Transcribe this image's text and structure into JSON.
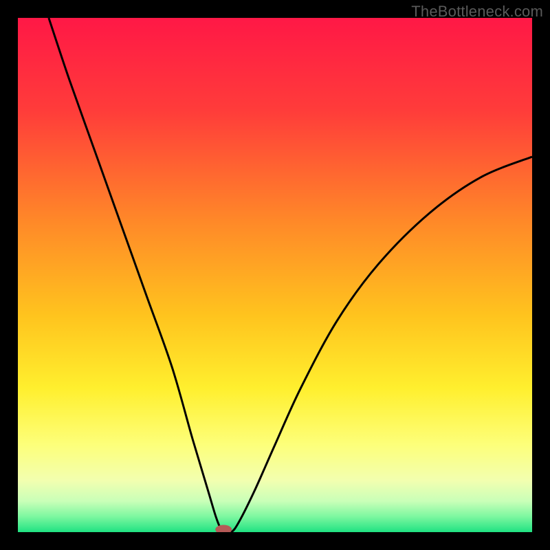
{
  "watermark": "TheBottleneck.com",
  "chart_data": {
    "type": "line",
    "title": "",
    "xlabel": "",
    "ylabel": "",
    "xlim": [
      0,
      100
    ],
    "ylim": [
      0,
      100
    ],
    "background_gradient": {
      "stops": [
        {
          "offset": 0,
          "color": "#ff1846"
        },
        {
          "offset": 18,
          "color": "#ff3c3a"
        },
        {
          "offset": 40,
          "color": "#ff8a28"
        },
        {
          "offset": 58,
          "color": "#ffc41e"
        },
        {
          "offset": 72,
          "color": "#ffef2e"
        },
        {
          "offset": 83,
          "color": "#fdff7a"
        },
        {
          "offset": 90,
          "color": "#f2ffb0"
        },
        {
          "offset": 94,
          "color": "#c9ffb8"
        },
        {
          "offset": 97,
          "color": "#7cf7a0"
        },
        {
          "offset": 100,
          "color": "#20e282"
        }
      ]
    },
    "series": [
      {
        "name": "bottleneck_curve",
        "x": [
          6,
          10,
          15,
          20,
          25,
          30,
          34,
          37,
          38.5,
          39.5,
          40,
          41.5,
          43,
          46,
          50,
          55,
          62,
          70,
          80,
          90,
          100
        ],
        "y": [
          100,
          88,
          74,
          60,
          46,
          32,
          18,
          8,
          3,
          0.5,
          0,
          0,
          2,
          8,
          17,
          28,
          41,
          52,
          62,
          69,
          73
        ],
        "stroke": "#000000",
        "stroke_width": 3
      }
    ],
    "markers": [
      {
        "name": "optimal_marker",
        "x": 40,
        "y": 0.5,
        "rx": 1.6,
        "ry": 0.9,
        "fill": "#b55a57"
      }
    ]
  }
}
